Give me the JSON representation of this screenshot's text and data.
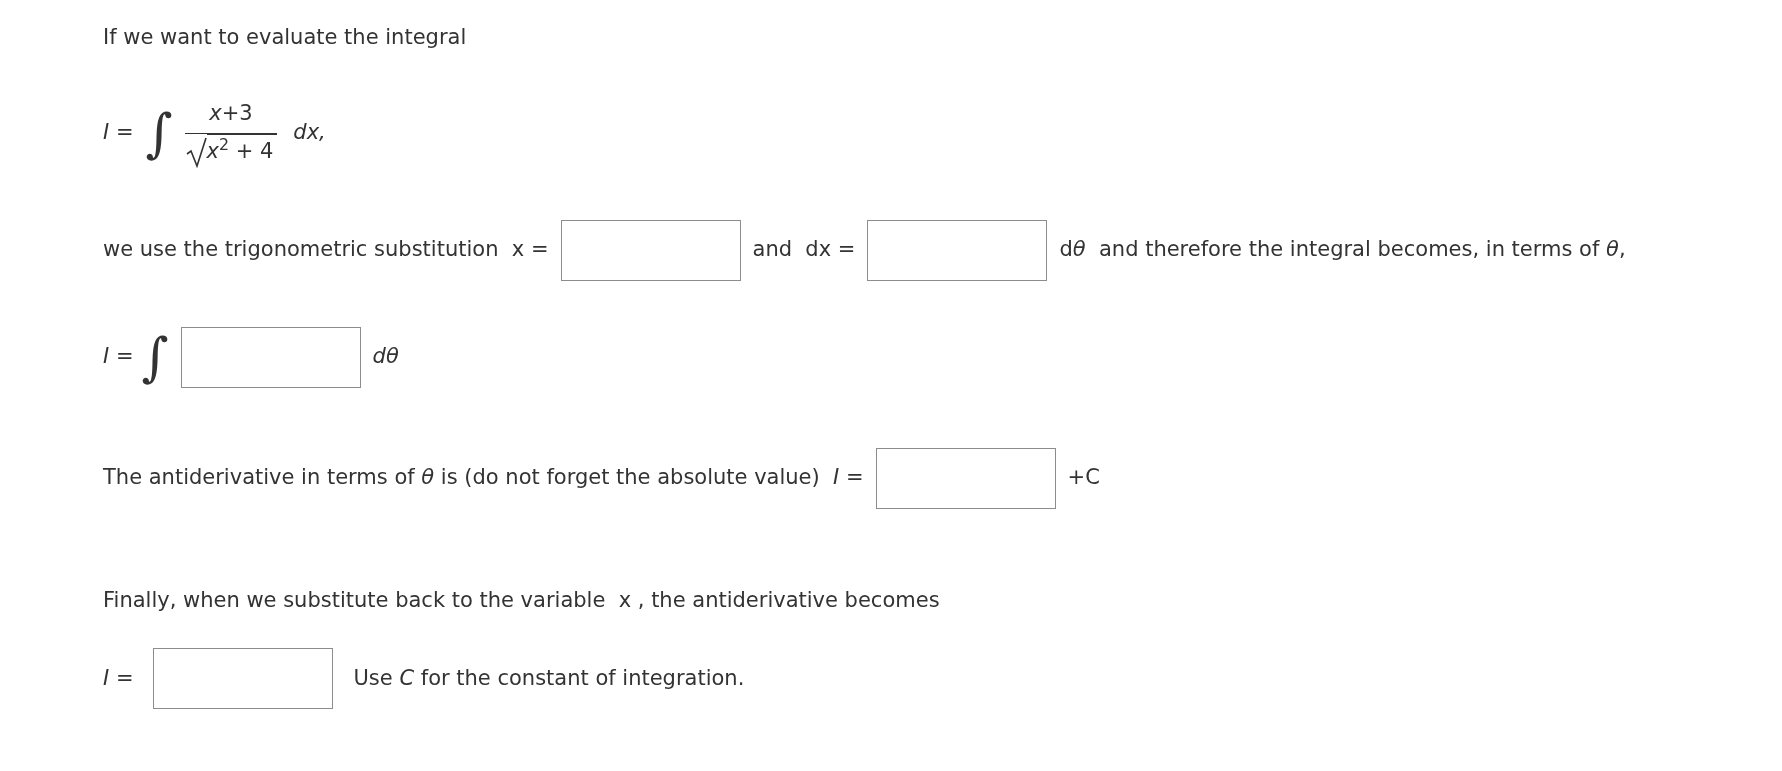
{
  "intro": "If we want to evaluate the integral",
  "integral": {
    "lhs": "*I* =",
    "sign": "∫",
    "numerator": "*x*+3",
    "denominator": "*x*$^{2}$ + 4",
    "differential": "dx,"
  },
  "substitution": [
    {
      "kind": "text",
      "text": "we use the trigonometric substitution  x ="
    },
    {
      "kind": "field"
    },
    {
      "kind": "text",
      "text": "and  dx ="
    },
    {
      "kind": "field"
    },
    {
      "kind": "joined",
      "pieces": [
        "d",
        "*θ*  and therefore the integral becomes, in terms of *θ*,"
      ]
    }
  ],
  "transformed": [
    {
      "kind": "text",
      "text": "*I* ="
    },
    {
      "kind": "integral",
      "text": "∫"
    },
    {
      "kind": "field"
    },
    {
      "kind": "text",
      "text": "*dθ*"
    }
  ],
  "antiderivative": [
    {
      "kind": "text",
      "text": "The antiderivative in terms of *θ* is (do not forget the absolute value)  *I* ="
    },
    {
      "kind": "field"
    },
    {
      "kind": "text",
      "text": "+C"
    }
  ],
  "back_substitution": "Finally, when we substitute back to the variable  x , the antiderivative becomes",
  "final": [
    {
      "kind": "text",
      "text": "*I* ="
    },
    {
      "kind": "field"
    },
    {
      "kind": "text",
      "text": "Use *C* for the constant of integration."
    }
  ]
}
